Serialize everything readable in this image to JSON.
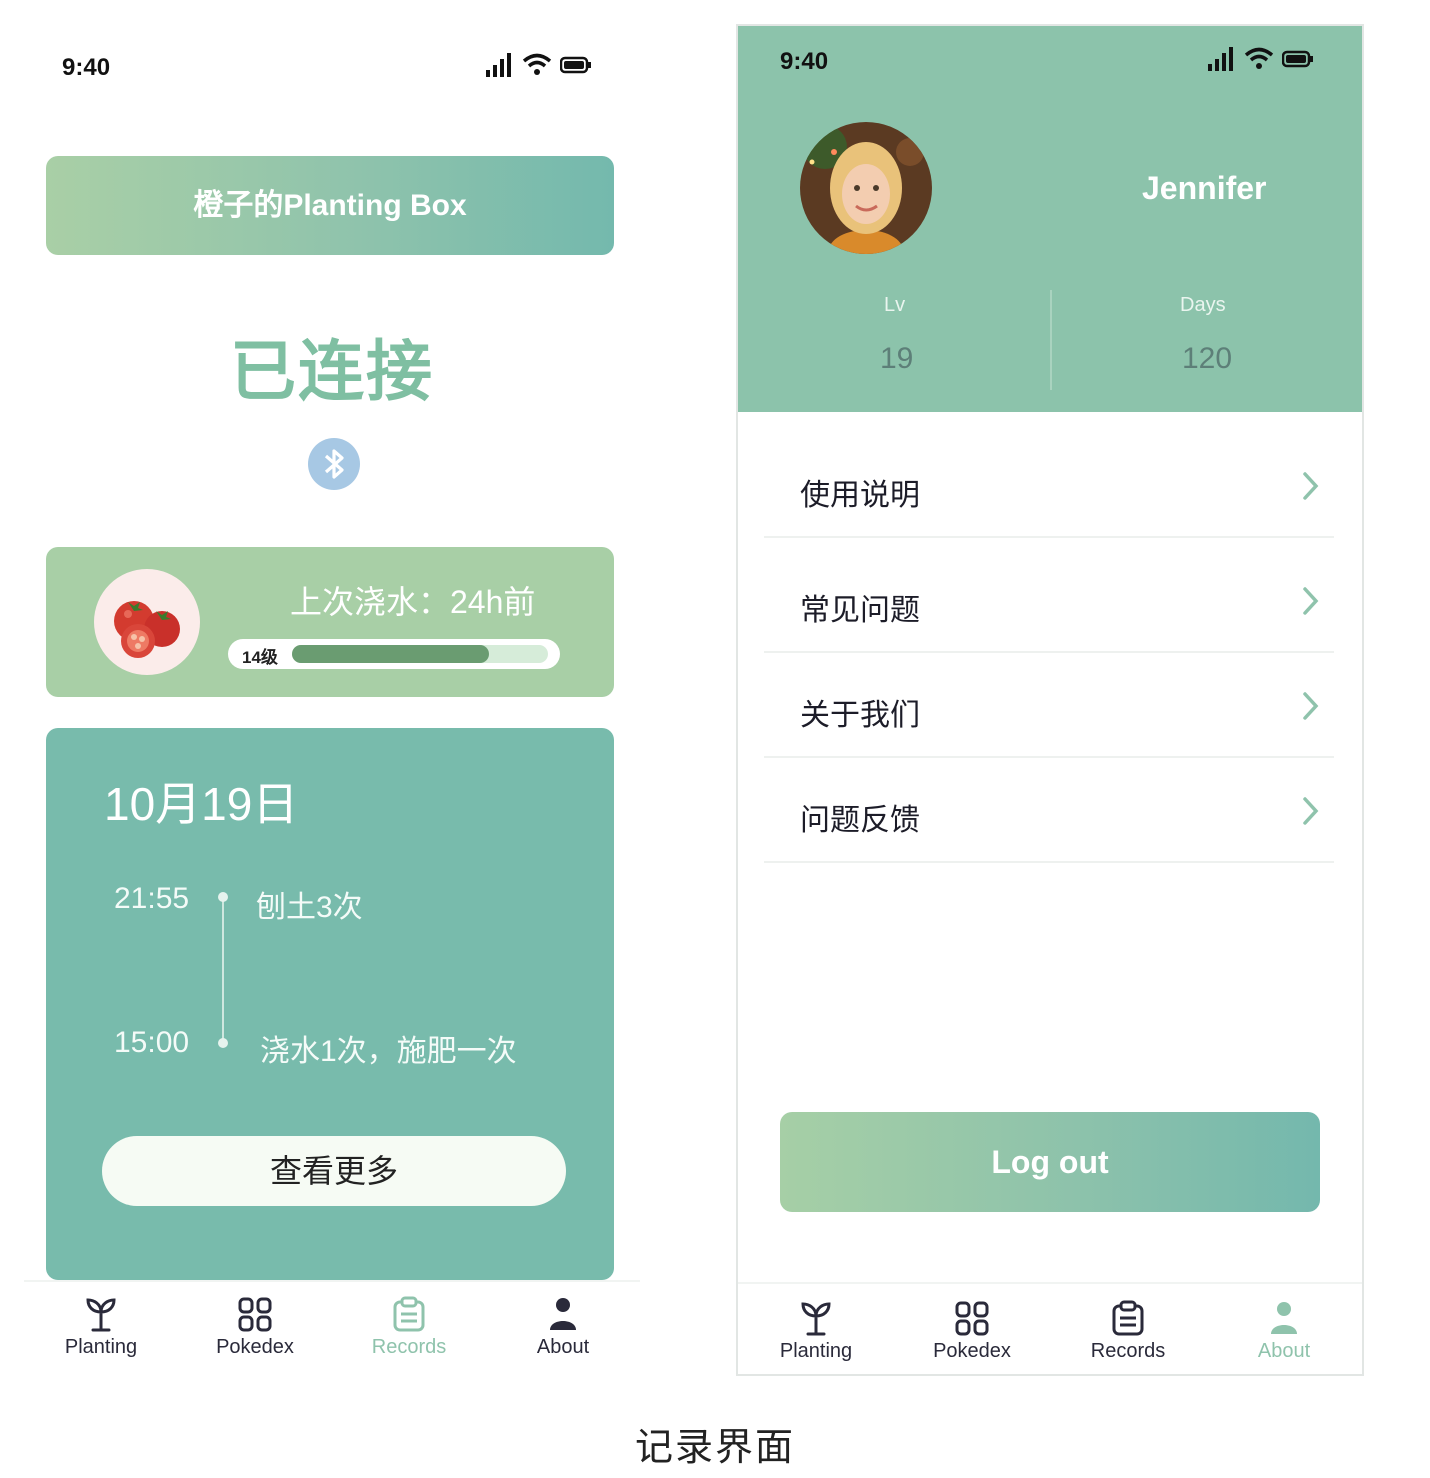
{
  "caption": "记录界面",
  "colors": {
    "accent": "#8cc3ab",
    "teal": "#78bbac",
    "leaf": "#a8cfa6",
    "bluetooth": "#a7c8e4"
  },
  "left_screen": {
    "status": {
      "time": "9:40",
      "icons": [
        "signal-icon",
        "wifi-icon",
        "battery-icon"
      ]
    },
    "box_title": "橙子的Planting Box",
    "connection_status": "已连接",
    "plant_card": {
      "last_watered": "上次浇水：24h前",
      "level_label": "14级",
      "level_progress": 0.77
    },
    "records": {
      "date": "10月19日",
      "entries": [
        {
          "time": "21:55",
          "text": "刨土3次"
        },
        {
          "time": "15:00",
          "text": "浇水1次，施肥一次"
        }
      ],
      "view_more": "查看更多"
    },
    "tabs": [
      {
        "label": "Planting",
        "icon": "sprout-icon",
        "active": false
      },
      {
        "label": "Pokedex",
        "icon": "grid-icon",
        "active": false
      },
      {
        "label": "Records",
        "icon": "clipboard-icon",
        "active": true
      },
      {
        "label": "About",
        "icon": "person-icon",
        "active": false
      }
    ]
  },
  "right_screen": {
    "status": {
      "time": "9:40",
      "icons": [
        "signal-icon",
        "wifi-icon",
        "battery-icon"
      ]
    },
    "profile": {
      "username": "Jennifer",
      "stats": [
        {
          "label": "Lv",
          "value": "19"
        },
        {
          "label": "Days",
          "value": "120"
        }
      ]
    },
    "menu": [
      {
        "label": "使用说明"
      },
      {
        "label": "常见问题"
      },
      {
        "label": "关于我们"
      },
      {
        "label": "问题反馈"
      }
    ],
    "logout": "Log out",
    "tabs": [
      {
        "label": "Planting",
        "icon": "sprout-icon",
        "active": false
      },
      {
        "label": "Pokedex",
        "icon": "grid-icon",
        "active": false
      },
      {
        "label": "Records",
        "icon": "clipboard-icon",
        "active": false
      },
      {
        "label": "About",
        "icon": "person-icon",
        "active": true
      }
    ]
  }
}
